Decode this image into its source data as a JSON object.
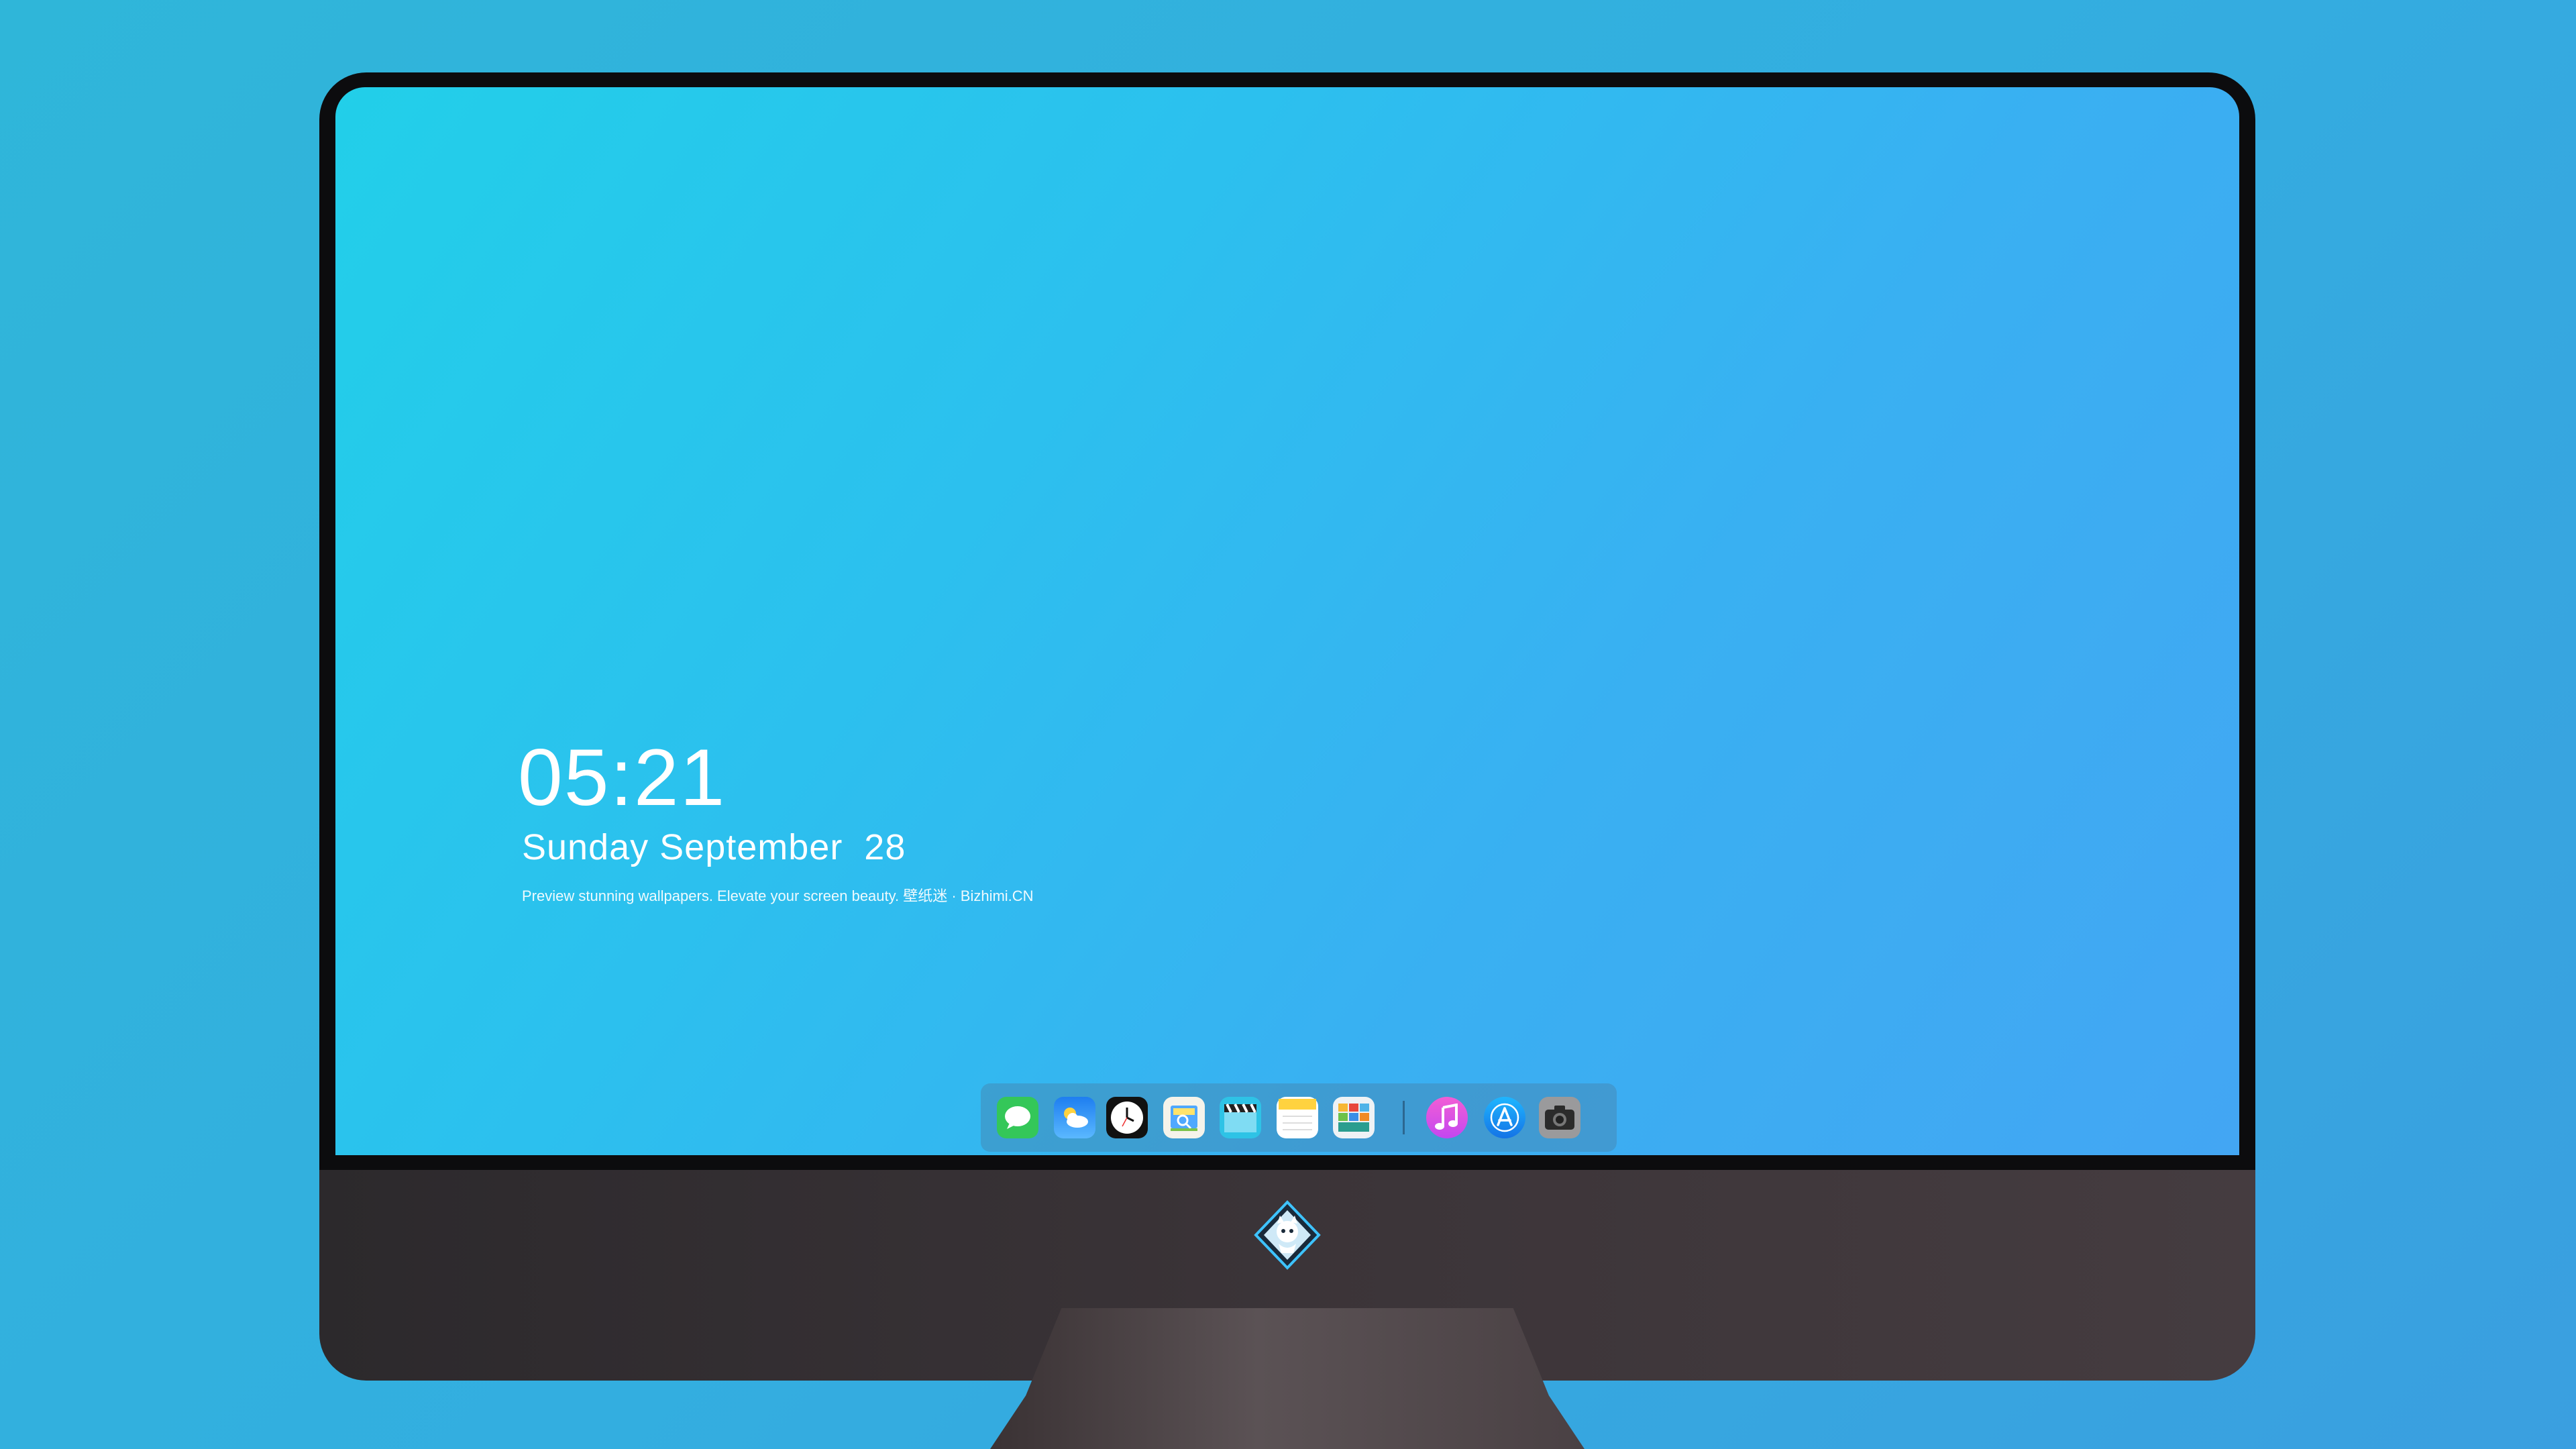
{
  "lockscreen": {
    "time": "05:21",
    "date": "Sunday September  28",
    "caption": "Preview stunning wallpapers. Elevate your screen beauty. 壁纸迷 · Bizhimi.CN"
  },
  "dock": {
    "items": [
      {
        "icon": "messages-icon"
      },
      {
        "icon": "weather-icon"
      },
      {
        "icon": "clock-icon"
      },
      {
        "icon": "preview-icon"
      },
      {
        "icon": "clapper-icon"
      },
      {
        "icon": "notes-icon"
      },
      {
        "icon": "photo-grid-icon"
      },
      {
        "icon": "music-icon"
      },
      {
        "icon": "app-store-icon"
      },
      {
        "icon": "camera-icon"
      }
    ]
  },
  "monitor": {
    "logo": "mascot-logo-icon"
  },
  "colors": {
    "wallpaper_start": "#22cfe9",
    "wallpaper_end": "#43a6f3",
    "background": "#33aee0",
    "chin": "#3b3438"
  }
}
